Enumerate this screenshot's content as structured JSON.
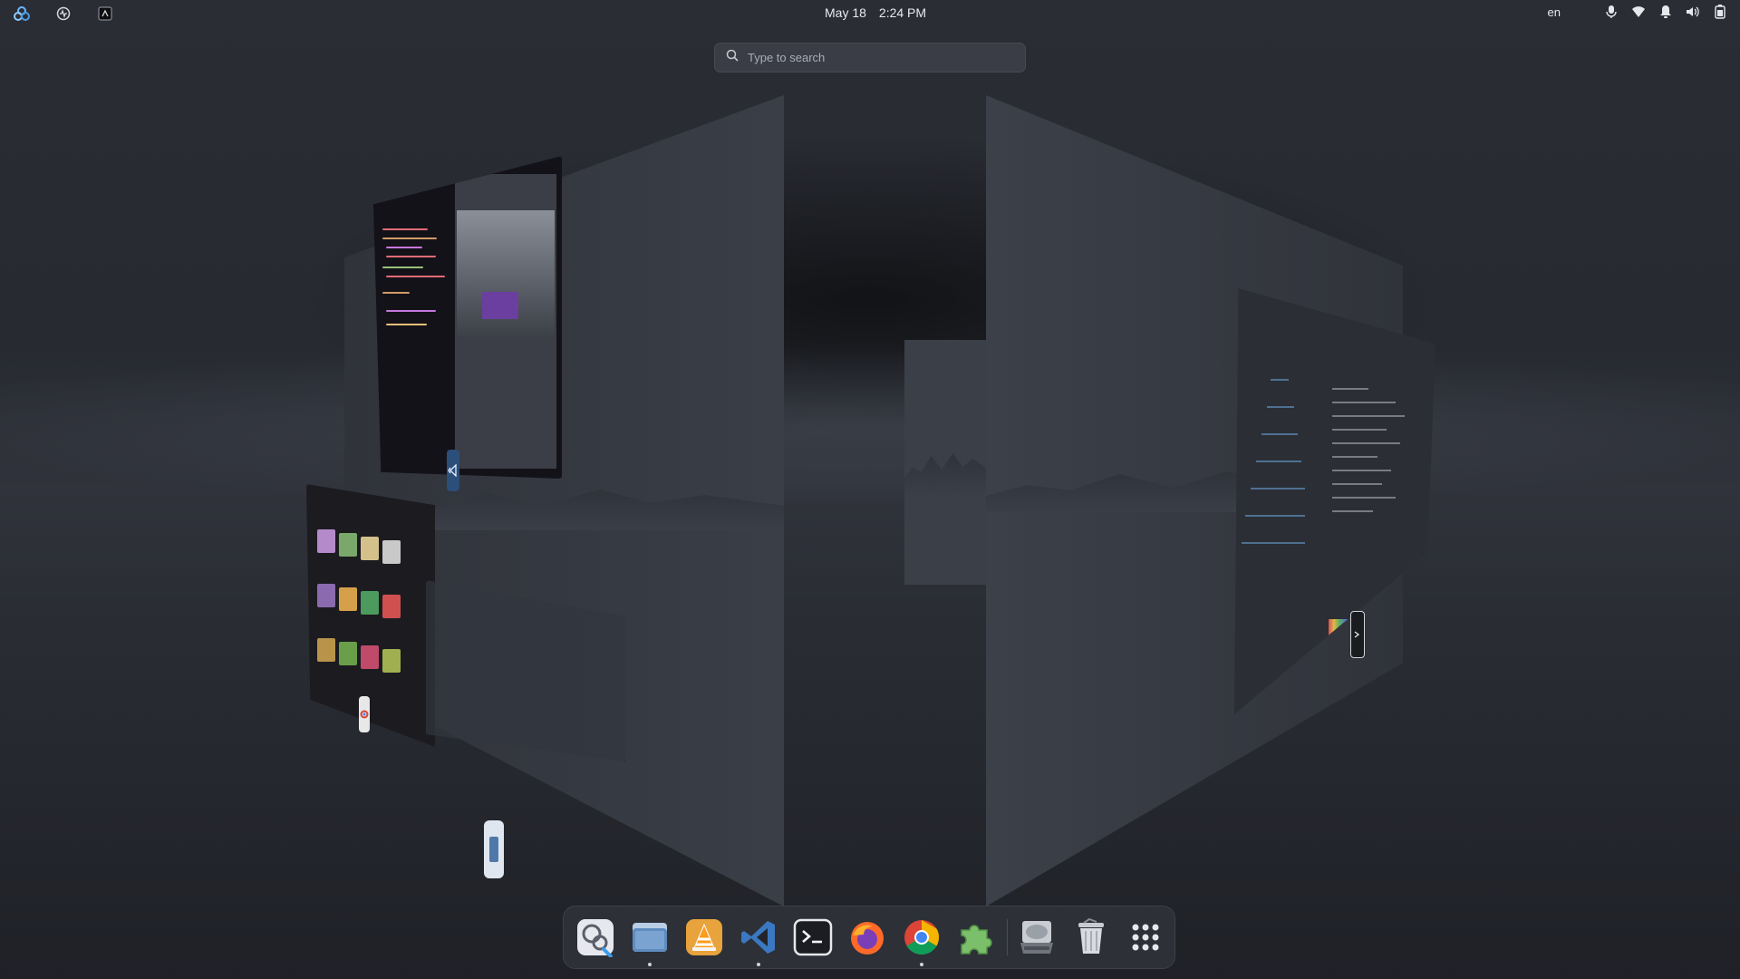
{
  "topbar": {
    "left_icons": [
      "distro-logo-icon",
      "system-monitor-icon",
      "tiling-icon"
    ],
    "date": "May 18",
    "time": "2:24 PM",
    "language": "en",
    "indicators": [
      "microphone-icon",
      "wifi-icon",
      "notification-bell-icon",
      "volume-icon",
      "battery-icon"
    ]
  },
  "search": {
    "placeholder": "Type to search"
  },
  "workspaces": {
    "windows": [
      {
        "app": "Visual Studio Code",
        "icon": "vscode-icon"
      },
      {
        "app": "Web Browser",
        "icon": "chrome-icon"
      },
      {
        "app": "Files",
        "icon": "files-icon"
      },
      {
        "app": "Terminal",
        "icon": "terminal-icon"
      }
    ]
  },
  "dock": {
    "items": [
      {
        "name": "tweaks",
        "icon": "tweaks-icon",
        "running": false
      },
      {
        "name": "files",
        "icon": "folder-icon",
        "running": true
      },
      {
        "name": "vlc",
        "icon": "vlc-cone-icon",
        "running": false
      },
      {
        "name": "vscode",
        "icon": "vscode-icon",
        "running": true
      },
      {
        "name": "terminal",
        "icon": "terminal-icon",
        "running": false
      },
      {
        "name": "firefox",
        "icon": "firefox-icon",
        "running": false
      },
      {
        "name": "chrome",
        "icon": "chrome-icon",
        "running": true
      },
      {
        "name": "extensions",
        "icon": "puzzle-piece-icon",
        "running": false
      },
      {
        "name": "disks",
        "icon": "hard-drive-icon",
        "running": false
      },
      {
        "name": "trash",
        "icon": "trash-icon",
        "running": false
      },
      {
        "name": "app-grid",
        "icon": "app-grid-icon",
        "running": false
      }
    ]
  },
  "colors": {
    "background": "#22252c",
    "dock": "#2d3037",
    "search": "#3a3d45",
    "accent": "#3d9be9"
  }
}
